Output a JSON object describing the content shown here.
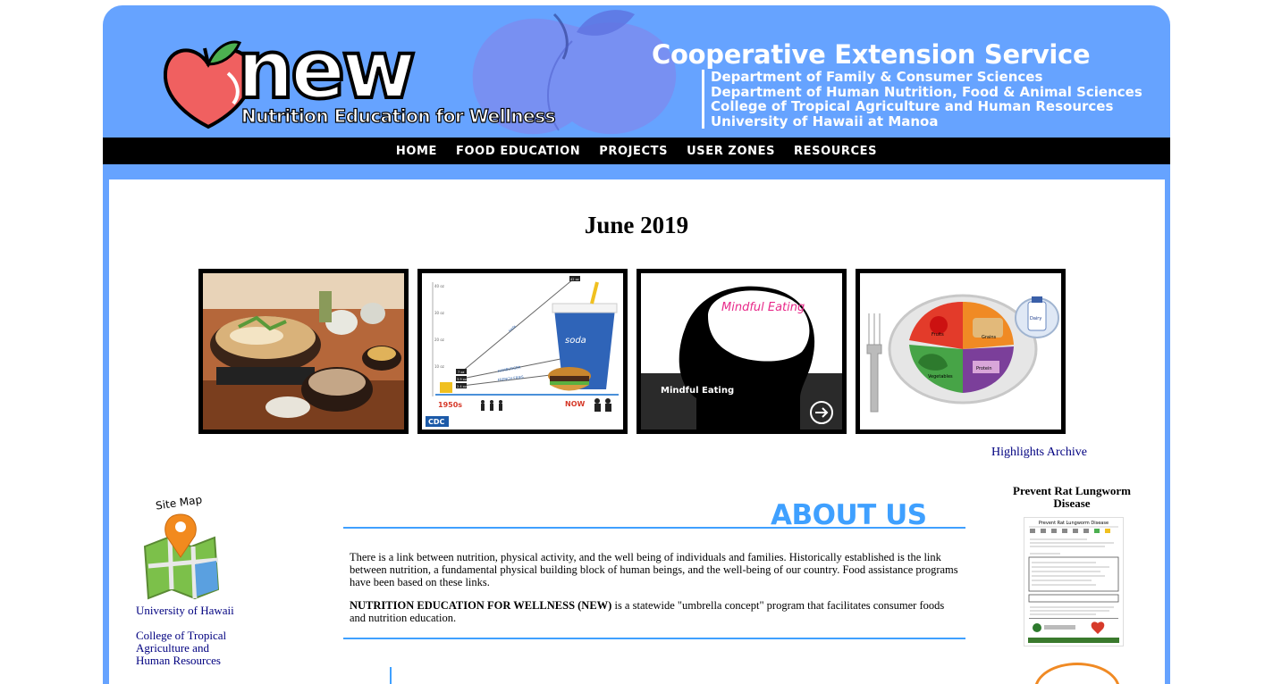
{
  "banner": {
    "logo_word": "new",
    "logo_subtitle": "Nutrition Education for Wellness",
    "org_title": "Cooperative Extension Service",
    "org_lines": [
      "Department of Family & Consumer Sciences",
      "Department of Human Nutrition, Food & Animal Sciences",
      "College of Tropical Agriculture and Human Resources",
      "University of Hawaii at Manoa"
    ]
  },
  "nav": {
    "items": [
      "HOME",
      "FOOD EDUCATION",
      "PROJECTS",
      "USER ZONES",
      "RESOURCES"
    ]
  },
  "highlights": {
    "title": "June 2019",
    "tiles": [
      {
        "name": "japanese-meal-photo"
      },
      {
        "name": "portion-sizes-infographic",
        "labels": {
          "soda": "soda",
          "hamburger": "HAMBURGER",
          "fries": "FRENCH FRIES",
          "then": "1950s",
          "now": "NOW",
          "cdc": "CDC",
          "y1": "40 oz",
          "y2": "30 oz",
          "y3": "20 oz",
          "y4": "10 oz",
          "v1": "7 oz",
          "v2": "3.9 oz",
          "v3": "2.4 oz",
          "v4": "42 oz",
          "v5": "12 oz",
          "v6": "6.7 oz"
        }
      },
      {
        "name": "mindful-eating-graphic",
        "labels": {
          "head_text": "Mindful Eating",
          "caption": "Mindful Eating"
        }
      },
      {
        "name": "myplate-graphic",
        "labels": {
          "fruits": "Fruits",
          "grains": "Grains",
          "vegetables": "Vegetables",
          "protein": "Protein",
          "dairy": "Dairy"
        }
      }
    ],
    "archive_link": "Highlights Archive"
  },
  "sidebar": {
    "sitemap_label": "Site Map",
    "links": [
      "University of Hawaii",
      "College of Tropical Agriculture and Human Resources"
    ]
  },
  "about": {
    "heading": "ABOUT US",
    "paragraph1": "There is a link between nutrition, physical activity, and the well being of individuals and families. Historically established is the link between nutrition, a fundamental physical building block of human beings, and the well-being of our country. Food assistance programs have been based on these links.",
    "paragraph2_bold": "NUTRITION EDUCATION FOR WELLNESS (NEW)",
    "paragraph2_rest": " is a statewide \"umbrella concept\" program that facilitates consumer foods and nutrition education."
  },
  "right_panel": {
    "title": "Prevent Rat Lungworm Disease",
    "poster_title": "Prevent Rat Lungworm Disease"
  },
  "colors": {
    "frame_blue": "#66a3ff",
    "accent_blue": "#3fa0ff",
    "link_navy": "#000080",
    "nav_black": "#000000"
  }
}
